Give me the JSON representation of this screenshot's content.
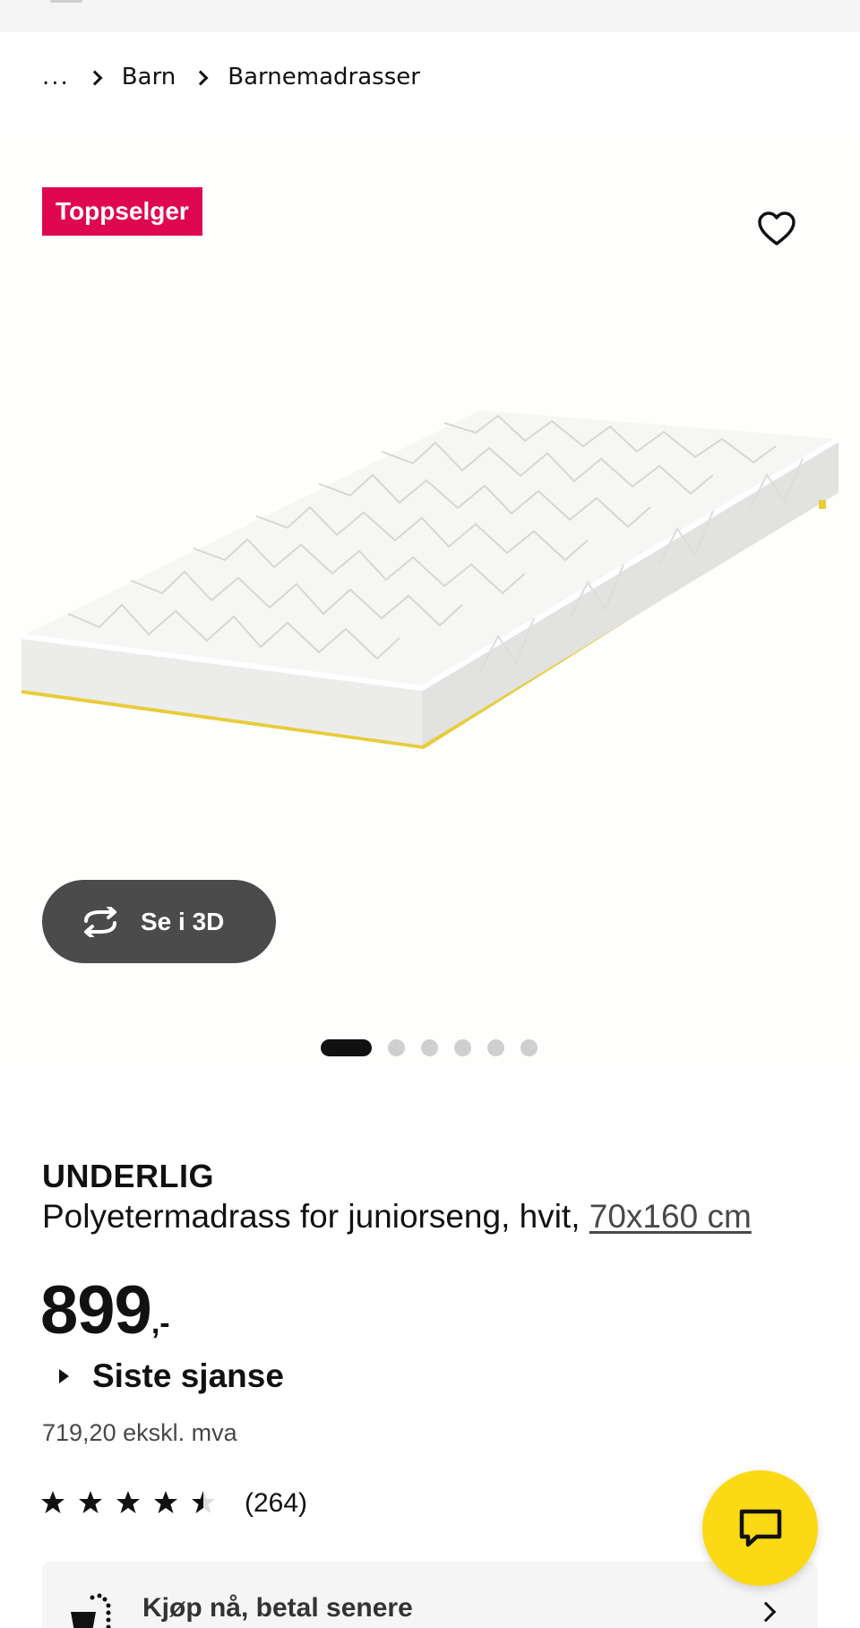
{
  "breadcrumb": {
    "items": [
      "...",
      "Barn",
      "Barnemadrasser"
    ]
  },
  "gallery": {
    "badge": "Toppselger",
    "view_3d_label": "Se i 3D",
    "image_count": 6,
    "active_index": 0
  },
  "product": {
    "brand": "UNDERLIG",
    "description": "Polyetermadrass for juniorseng, hvit,",
    "size": "70x160 cm",
    "price": "899",
    "price_suffix": ",-",
    "last_chance": "Siste sjanse",
    "price_ex_vat": "719,20 ekskl. mva",
    "rating": 4.5,
    "review_count": "(264)"
  },
  "bnpl": {
    "label": "Kjøp nå, betal senere"
  },
  "colors": {
    "badge": "#e00751",
    "chat": "#fbd914",
    "btn3d": "#4b4b4b"
  },
  "icons": [
    "heart-icon",
    "rotate-3d-icon",
    "star-icon",
    "chat-icon",
    "cart-dotted-icon",
    "chevron-right-icon"
  ]
}
